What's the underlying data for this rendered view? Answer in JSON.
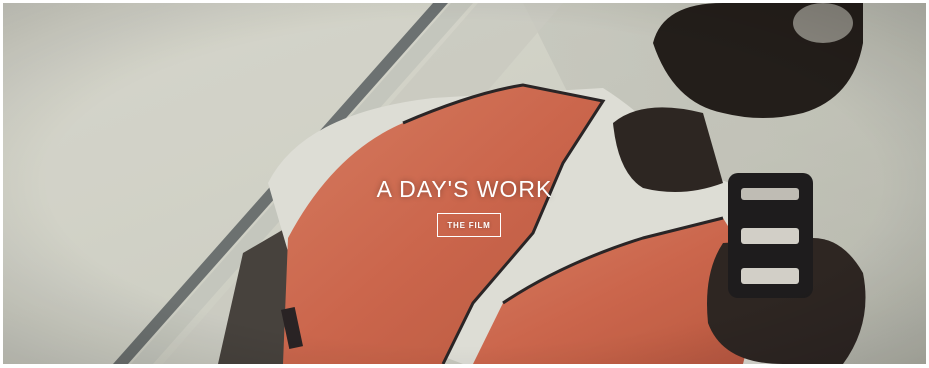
{
  "hero": {
    "title": "A DAY'S WORK",
    "button_label": "THE FILM"
  },
  "colors": {
    "vest_orange": "#d96a4e",
    "shirt_white": "#ecece6",
    "wall": "#dcdcd2",
    "skin_dark": "#2a2420",
    "text_white": "#ffffff"
  }
}
